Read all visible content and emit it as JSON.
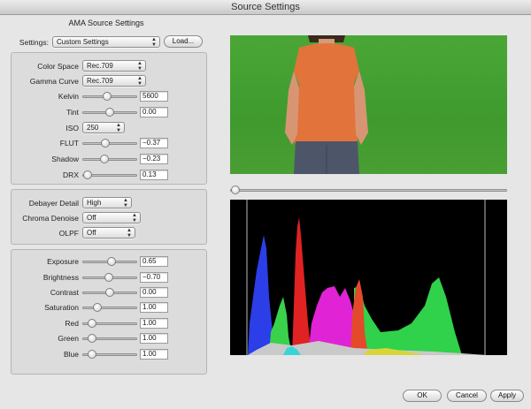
{
  "window": {
    "title": "Source Settings"
  },
  "panel": {
    "title": "AMA Source Settings"
  },
  "settings": {
    "label": "Settings:",
    "value": "Custom Settings",
    "load_label": "Load..."
  },
  "color_group": {
    "color_space": {
      "label": "Color Space",
      "value": "Rec.709"
    },
    "gamma_curve": {
      "label": "Gamma Curve",
      "value": "Rec.709"
    },
    "kelvin": {
      "label": "Kelvin",
      "value": "5600",
      "level": 0.45
    },
    "tint": {
      "label": "Tint",
      "value": "0.00",
      "level": 0.5
    },
    "iso": {
      "label": "ISO",
      "value": "250"
    },
    "flut": {
      "label": "FLUT",
      "value": "−0.37",
      "level": 0.42
    },
    "shadow": {
      "label": "Shadow",
      "value": "−0.23",
      "level": 0.4
    },
    "drx": {
      "label": "DRX",
      "value": "0.13",
      "level": 0.1
    }
  },
  "debayer_group": {
    "debayer_detail": {
      "label": "Debayer Detail",
      "value": "High"
    },
    "chroma_denoise": {
      "label": "Chroma Denoise",
      "value": "Off"
    },
    "olpf": {
      "label": "OLPF",
      "value": "Off"
    }
  },
  "grade_group": {
    "exposure": {
      "label": "Exposure",
      "value": "0.65",
      "level": 0.53
    },
    "brightness": {
      "label": "Brightness",
      "value": "−0.70",
      "level": 0.48
    },
    "contrast": {
      "label": "Contrast",
      "value": "0.00",
      "level": 0.5
    },
    "saturation": {
      "label": "Saturation",
      "value": "1.00",
      "level": 0.28
    },
    "red": {
      "label": "Red",
      "value": "1.00",
      "level": 0.18
    },
    "green": {
      "label": "Green",
      "value": "1.00",
      "level": 0.18
    },
    "blue": {
      "label": "Blue",
      "value": "1.00",
      "level": 0.18
    }
  },
  "buttons": {
    "ok": "OK",
    "cancel": "Cancel",
    "apply": "Apply"
  },
  "scrubber": {
    "position": 0.02
  },
  "colors": {
    "green_screen": "#3f9d2e",
    "shirt": "#e0733a",
    "accent": "#3b6fd6"
  }
}
